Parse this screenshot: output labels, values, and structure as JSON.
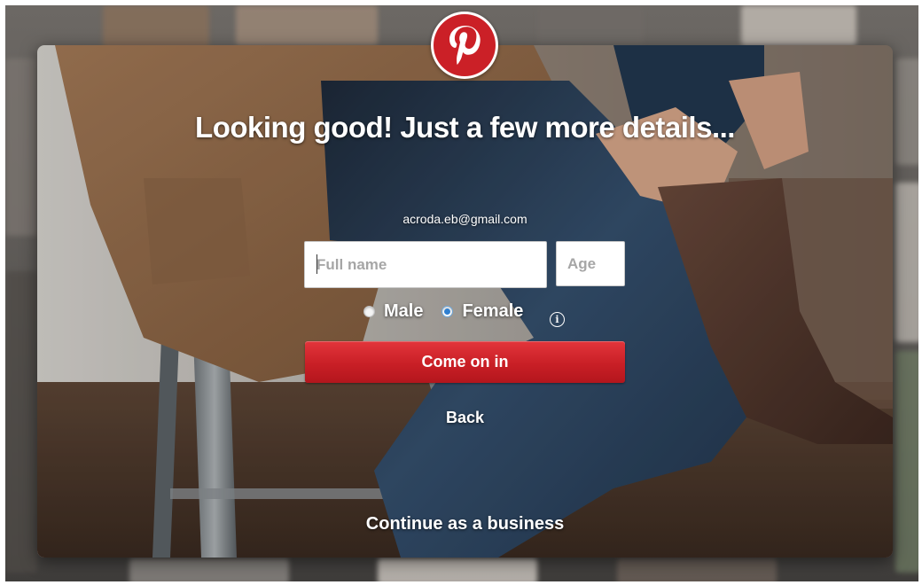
{
  "brand": {
    "logo_icon": "pinterest-p-icon",
    "color": "#cb2027"
  },
  "headline": "Looking good! Just a few more details...",
  "email": "acroda.eb@gmail.com",
  "form": {
    "full_name": {
      "value": "",
      "placeholder": "Full name"
    },
    "age": {
      "value": "",
      "placeholder": "Age"
    },
    "gender": {
      "options": [
        {
          "label": "Male",
          "checked": false
        },
        {
          "label": "Female",
          "checked": true
        }
      ],
      "info_icon": "info-icon"
    },
    "submit_label": "Come on in",
    "submit_color": "#cb2027"
  },
  "back_label": "Back",
  "business_label": "Continue as a business"
}
